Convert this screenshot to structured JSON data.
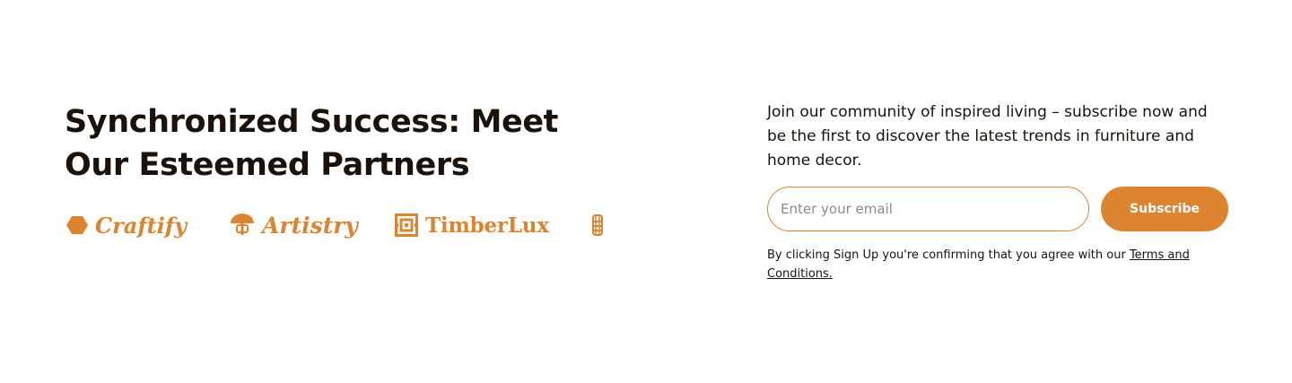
{
  "partners": {
    "heading": "Synchronized Success: Meet Our Esteemed Partners",
    "logos": [
      {
        "name": "Craftify",
        "icon": "hexagon-icon"
      },
      {
        "name": "Artistry",
        "icon": "umbrella-icon"
      },
      {
        "name": "TimberLux",
        "icon": "square-frame-icon"
      },
      {
        "name": "",
        "icon": "stacked-rings-icon"
      }
    ]
  },
  "newsletter": {
    "intro": "Join our community of inspired living – subscribe now and be the first to discover the latest trends in furniture and home decor.",
    "email_placeholder": "Enter your email",
    "subscribe_label": "Subscribe",
    "disclaimer_text": "By clicking Sign Up you're confirming that you agree with our ",
    "terms_link": "Terms and Conditions."
  },
  "colors": {
    "accent": "#dd8431",
    "text": "#1a120b",
    "background": "#ffffff"
  }
}
